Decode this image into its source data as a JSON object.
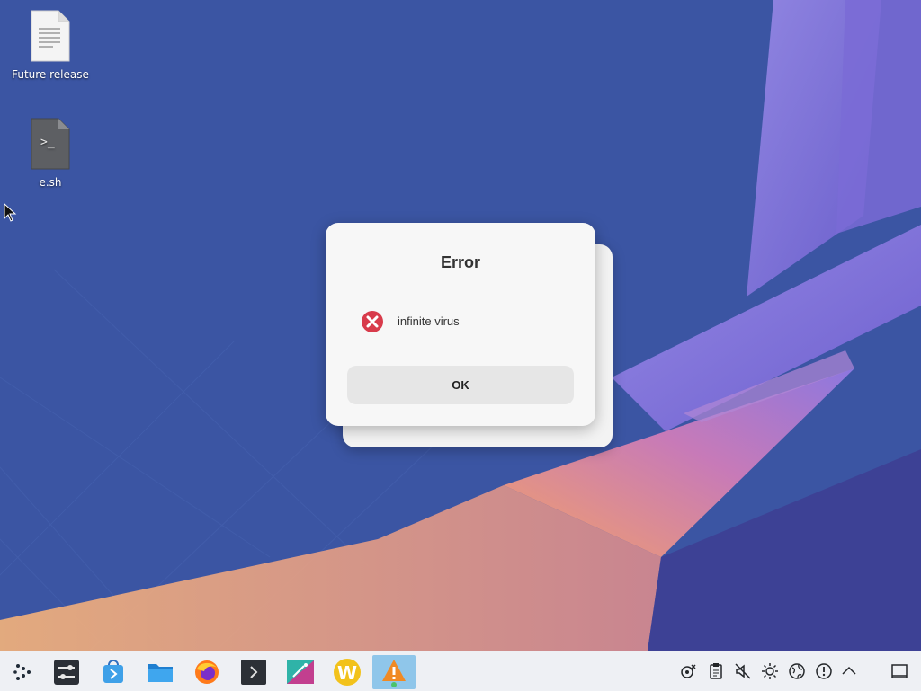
{
  "desktop": {
    "icons": [
      {
        "label": "Future release",
        "icon": "text-document-icon"
      },
      {
        "label": "e.sh",
        "icon": "shell-script-icon"
      }
    ]
  },
  "dialog": {
    "title": "Error",
    "message": "infinite virus",
    "ok_label": "OK",
    "icon": "error-icon"
  },
  "taskbar": {
    "launchers": [
      "application-launcher-icon",
      "system-settings-icon",
      "software-store-icon",
      "file-manager-icon",
      "firefox-icon",
      "terminal-icon",
      "screenshot-tool-icon",
      "wine-icon",
      "warning-app-icon"
    ],
    "tray": [
      "network-disconnected-icon",
      "clipboard-icon",
      "volume-muted-icon",
      "brightness-icon",
      "globe-icon",
      "updates-icon",
      "show-hidden-icon"
    ],
    "show_desktop": "show-desktop-icon"
  },
  "colors": {
    "accent": "#8fc6ea",
    "error": "#d83b4b",
    "taskbar_bg": "#eef0f4"
  }
}
